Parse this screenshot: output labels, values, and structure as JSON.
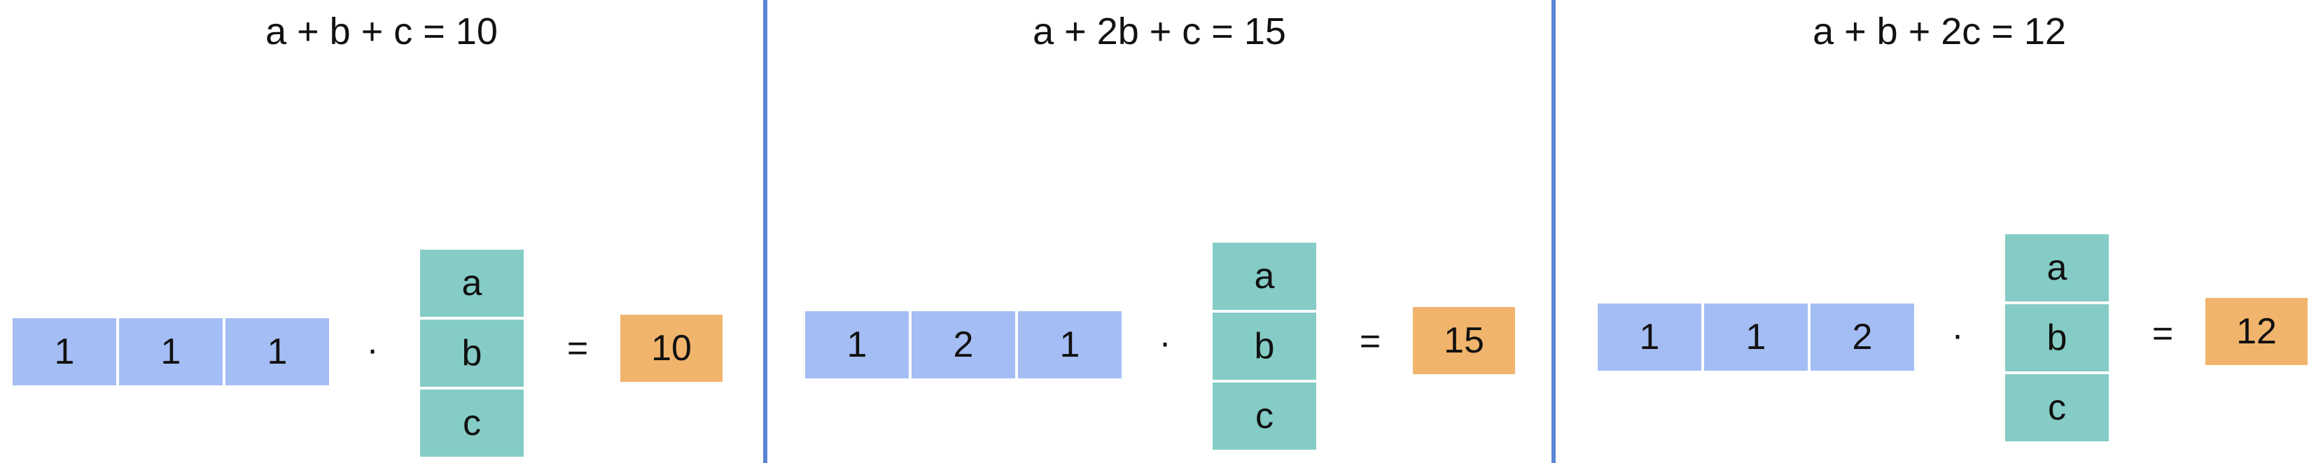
{
  "panels": [
    {
      "equation": "a + b + c = 10",
      "row": [
        "1",
        "1",
        "1"
      ],
      "dot": "·",
      "column": [
        "a",
        "b",
        "c"
      ],
      "equals": "=",
      "result": "10"
    },
    {
      "equation": "a + 2b + c = 15",
      "row": [
        "1",
        "2",
        "1"
      ],
      "dot": "·",
      "column": [
        "a",
        "b",
        "c"
      ],
      "equals": "=",
      "result": "15"
    },
    {
      "equation": "a + b + 2c = 12",
      "row": [
        "1",
        "1",
        "2"
      ],
      "dot": "·",
      "column": [
        "a",
        "b",
        "c"
      ],
      "equals": "=",
      "result": "12"
    }
  ],
  "colors": {
    "row_vector": "#a4bdf4",
    "column_vector": "#85ccc6",
    "result": "#f1b46c",
    "divider": "#5b86d6"
  }
}
